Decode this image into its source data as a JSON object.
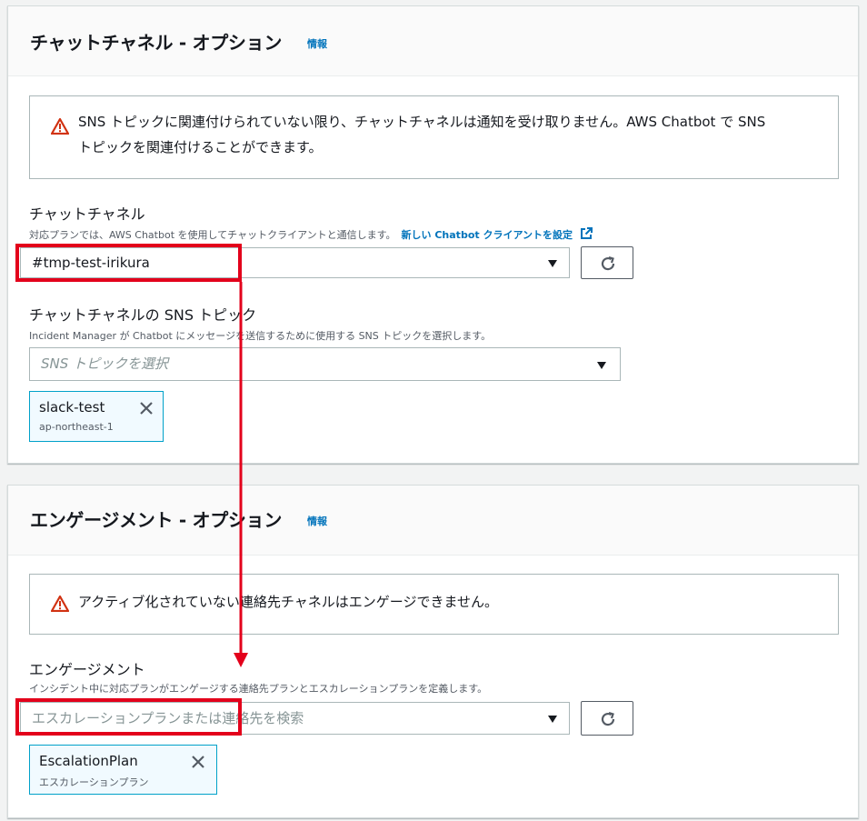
{
  "chat_section": {
    "title": "チャットチャネル - オプション",
    "info_link": "情報",
    "alert_line1": "SNS トピックに関連付けられていない限り、チャットチャネルは通知を受け取りません。AWS Chatbot で SNS",
    "alert_line2": "トピックを関連付けることができます。",
    "channel_label": "チャットチャネル",
    "channel_desc": "対応プランでは、AWS Chatbot を使用してチャットクライアントと通信します。",
    "channel_link": "新しい Chatbot クライアントを設定",
    "channel_value": "#tmp-test-irikura",
    "sns_label": "チャットチャネルの SNS トピック",
    "sns_desc": "Incident Manager が Chatbot にメッセージを送信するために使用する SNS トピックを選択します。",
    "sns_placeholder": "SNS トピックを選択",
    "sns_token": {
      "name": "slack-test",
      "region": "ap-northeast-1"
    }
  },
  "engagement_section": {
    "title": "エンゲージメント - オプション",
    "info_link": "情報",
    "alert_text": "アクティブ化されていない連絡先チャネルはエンゲージできません。",
    "engagement_label": "エンゲージメント",
    "engagement_desc": "インシデント中に対応プランがエンゲージする連絡先プランとエスカレーションプランを定義します。",
    "search_placeholder": "エスカレーションプランまたは連絡先を検索",
    "token": {
      "name": "EscalationPlan",
      "type": "エスカレーションプラン"
    }
  },
  "icons": [
    "warning-icon",
    "external-link-icon",
    "refresh-icon",
    "caret-down-icon",
    "close-icon"
  ],
  "colors": {
    "link": "#0073bb",
    "warning": "#d13212",
    "annotation": "#e3001b",
    "token_border": "#00a1c9"
  }
}
